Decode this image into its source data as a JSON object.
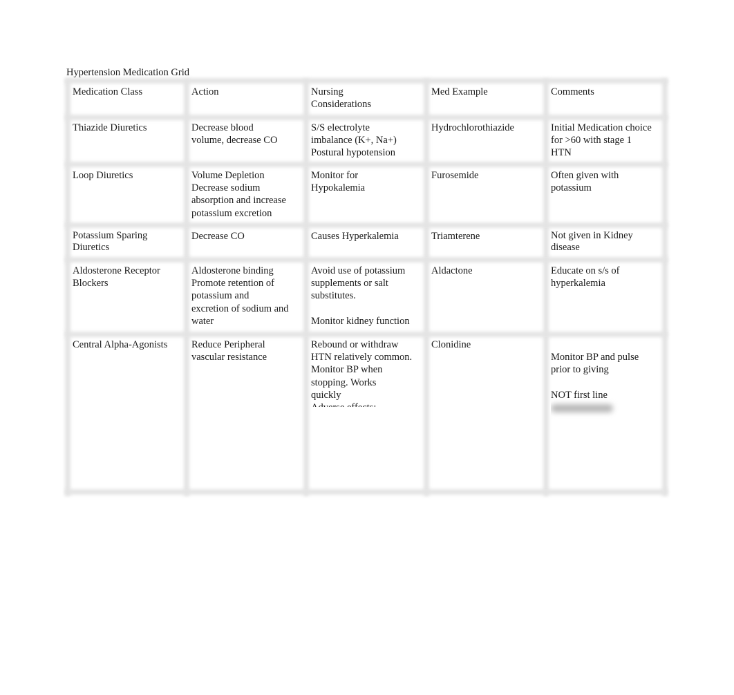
{
  "document": {
    "title": "Hypertension Medication Grid"
  },
  "table": {
    "headers": [
      "Medication Class",
      "Action",
      "Nursing\nConsiderations",
      "Med Example",
      "Comments"
    ],
    "rows": [
      {
        "medication_class": "Thiazide Diuretics",
        "action": "Decrease blood\nvolume, decrease CO",
        "nursing": "S/S electrolyte\nimbalance (K+, Na+)\nPostural hypotension",
        "example": "Hydrochlorothiazide",
        "comments": "Initial Medication choice\nfor >60 with stage 1\nHTN"
      },
      {
        "medication_class": "Loop Diuretics",
        "action": "Volume Depletion\nDecrease sodium\nabsorption and increase\npotassium excretion",
        "nursing": "Monitor for\nHypokalemia",
        "example": "Furosemide",
        "comments": "Often given with\npotassium"
      },
      {
        "medication_class": "Potassium Sparing\nDiuretics",
        "action": "Decrease CO",
        "nursing": "Causes Hyperkalemia",
        "example": "Triamterene",
        "comments": "Not given in Kidney\ndisease"
      },
      {
        "medication_class": "Aldosterone Receptor\nBlockers",
        "action": "Aldosterone binding\nPromote retention of\npotassium and\nexcretion of sodium and\nwater",
        "nursing": "Avoid use of potassium\nsupplements or salt\nsubstitutes.\n\nMonitor kidney function",
        "example": "Aldactone",
        "comments": "Educate on s/s of\nhyperkalemia"
      },
      {
        "medication_class": "Central Alpha-Agonists",
        "action": "Reduce Peripheral\nvascular resistance",
        "nursing": "Rebound or withdraw\nHTN relatively common.\nMonitor BP when\nstopping. Works\nquickly\nAdverse effects:",
        "example": "Clonidine",
        "comments": "Monitor BP and pulse\nprior to giving\n\nNOT first line"
      }
    ]
  }
}
